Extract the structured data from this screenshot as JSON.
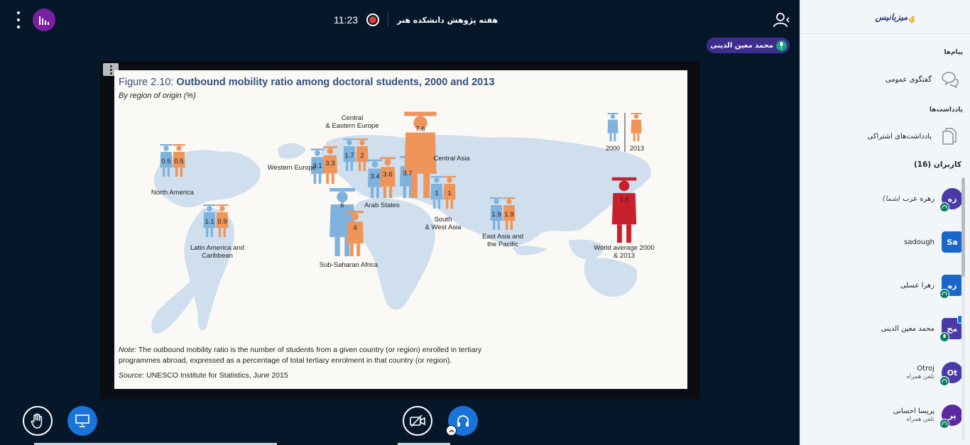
{
  "session": {
    "time": "11:23",
    "title": "هفته پژوهش دانشکده هنر"
  },
  "presenter_pill": {
    "name": "محمد معین الدینی"
  },
  "slide": {
    "title_prefix": "Figure 2.10: ",
    "title_bold": "Outbound mobility ratio among doctoral students, 2000 and 2013",
    "subtitle": "By region of origin (%)",
    "note_label": "Note:",
    "note_text": " The outbound mobility ratio is the number of students from a given country (or region) enrolled in tertiary programmes abroad, expressed as a percentage of total tertiary enrolment in that country (or region).",
    "source_label": "Source:",
    "source_text": " UNESCO Institute for Statistics, June 2015"
  },
  "chart_data": {
    "type": "bar",
    "title": "Figure 2.10: Outbound mobility ratio among doctoral students, 2000 and 2013",
    "subtitle": "By region of origin (%)",
    "series": [
      {
        "name": "2000",
        "color": "#7fb2dd",
        "values": [
          0.5,
          1.1,
          3.1,
          1.7,
          6.0,
          3.4,
          3.7,
          1.0,
          1.9,
          1.8
        ]
      },
      {
        "name": "2013",
        "color": "#f0955a",
        "values": [
          0.5,
          0.9,
          3.3,
          2.0,
          4.0,
          3.6,
          7.6,
          1.0,
          1.9,
          1.8
        ]
      }
    ],
    "categories": [
      "North America",
      "Latin America and Caribbean",
      "Western Europe",
      "Central & Eastern Europe",
      "Sub-Saharan Africa",
      "Arab States",
      "Central Asia",
      "South & West Asia",
      "East Asia and the Pacific",
      "World average 2000 & 2013"
    ],
    "legend": [
      "2000",
      "2013"
    ],
    "world_average_color": "#c8202d"
  },
  "sidebar": {
    "logo_text": "میزبانیس",
    "messages_title": "پیام‌ها",
    "public_chat": "گفتگوی عمومی",
    "notes_title": "یادداشت‌ها",
    "shared_notes": "یادداشت‌های اشتراکی",
    "users_title": "کاربران (16)",
    "users": [
      {
        "initials": "زه",
        "name": "زهره عرب",
        "you": "(شما)",
        "sub": "",
        "color": "#4a3aa8"
      },
      {
        "initials": "Sa",
        "name": "sadough",
        "you": "",
        "sub": "",
        "color": "#1a66c9"
      },
      {
        "initials": "زه",
        "name": "زهرا عسلی",
        "you": "",
        "sub": "",
        "color": "#1a66c9"
      },
      {
        "initials": "مح",
        "name": "محمد معین الدینی",
        "you": "",
        "sub": "",
        "color": "#4a3aa8"
      },
      {
        "initials": "Ot",
        "name": "Otroj",
        "you": "",
        "sub": "تلفن همراه",
        "color": "#4a3aa8"
      },
      {
        "initials": "پر",
        "name": "پریسا احسانی",
        "you": "",
        "sub": "تلفن همراه",
        "color": "#5b2aa0"
      }
    ]
  }
}
